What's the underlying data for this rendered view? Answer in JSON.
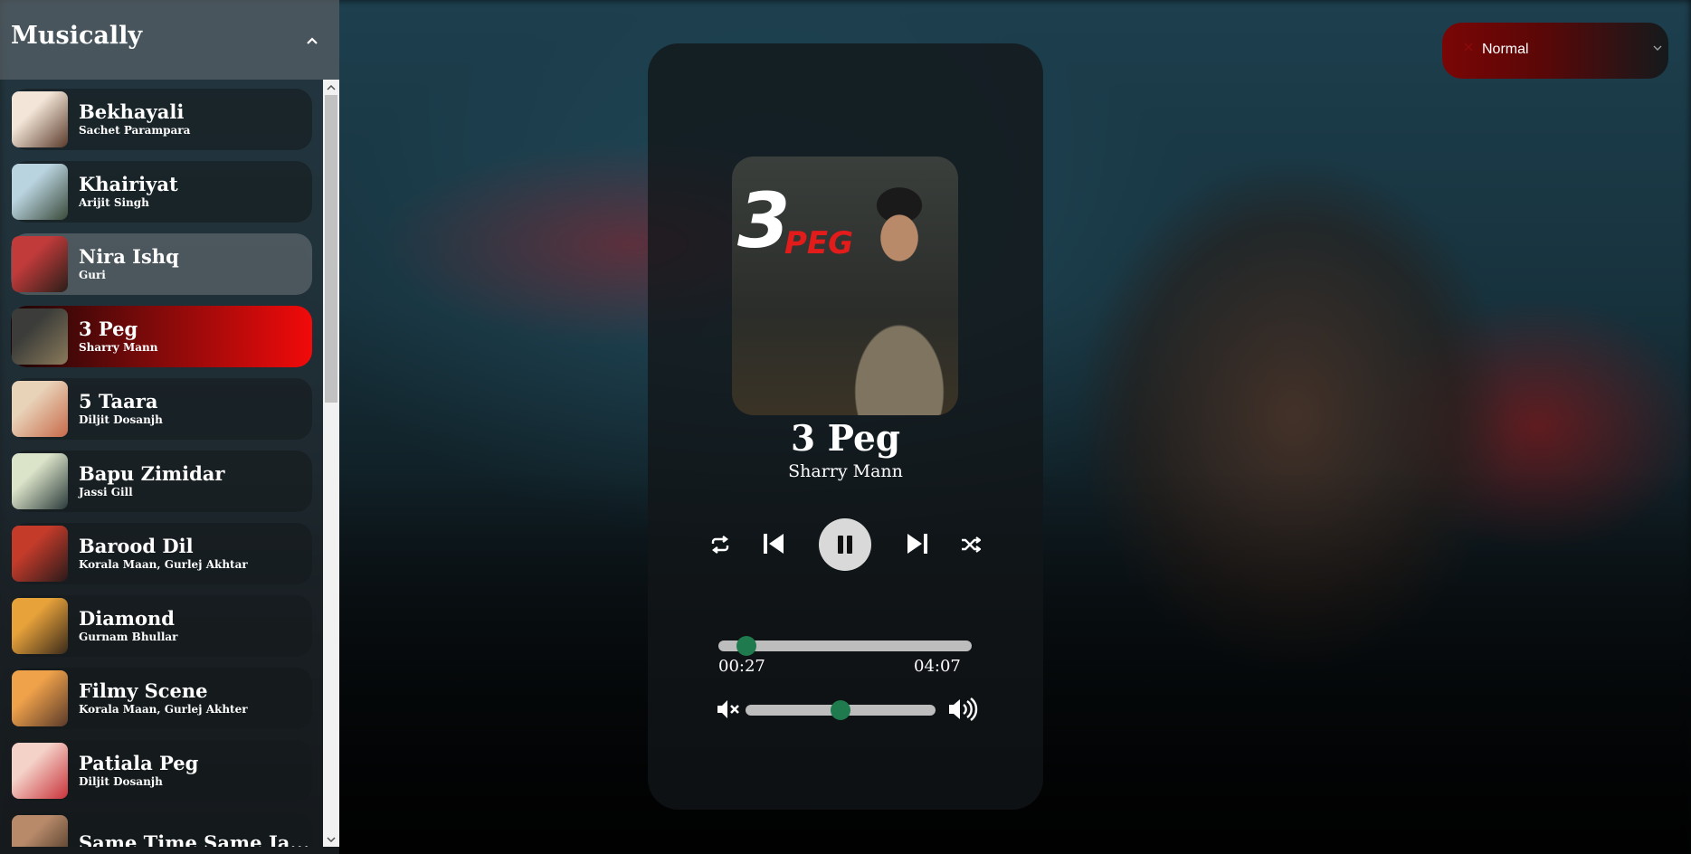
{
  "app": {
    "title": "Musically"
  },
  "playlist": [
    {
      "song": "Bekhayali",
      "artist": "Sachet Parampara",
      "thumb": [
        "#f3e6d8",
        "#5a3a2a"
      ]
    },
    {
      "song": "Khairiyat",
      "artist": "Arijit Singh",
      "thumb": [
        "#b9d3df",
        "#3a4a3a"
      ]
    },
    {
      "song": "Nira Ishq",
      "artist": "Guri",
      "thumb": [
        "#c23b3b",
        "#2a1e18"
      ]
    },
    {
      "song": "3 Peg",
      "artist": "Sharry Mann",
      "thumb": [
        "#3c3d3a",
        "#8a7a5a"
      ]
    },
    {
      "song": "5 Taara",
      "artist": "Diljit Dosanjh",
      "thumb": [
        "#e8d2b8",
        "#c86a4a"
      ]
    },
    {
      "song": "Bapu Zimidar",
      "artist": "Jassi Gill",
      "thumb": [
        "#dbe3c8",
        "#2a3a3a"
      ]
    },
    {
      "song": "Barood Dil",
      "artist": "Korala Maan, Gurlej Akhtar",
      "thumb": [
        "#c43b2a",
        "#2a1a1a"
      ]
    },
    {
      "song": "Diamond",
      "artist": "Gurnam Bhullar",
      "thumb": [
        "#e8a23a",
        "#3a2a1a"
      ]
    },
    {
      "song": "Filmy Scene",
      "artist": "Korala Maan, Gurlej Akhter",
      "thumb": [
        "#f0a24a",
        "#5a3a2a"
      ]
    },
    {
      "song": "Patiala Peg",
      "artist": "Diljit Dosanjh",
      "thumb": [
        "#f4d2c8",
        "#c8323a"
      ]
    },
    {
      "song": "Same Time Same Ja...",
      "artist": "",
      "thumb": [
        "#b88a6a",
        "#3a2a1a"
      ]
    }
  ],
  "now_playing": {
    "title": "3 Peg",
    "artist": "Sharry Mann",
    "cover_text_main": "3",
    "cover_text_sub": "PEG",
    "current_time": "00:27",
    "duration": "04:07",
    "progress_fraction": 0.11,
    "volume_fraction": 0.5
  },
  "controls": {
    "repeat_icon": "repeat-icon",
    "prev_icon": "skip-previous-icon",
    "play_icon": "pause-icon",
    "next_icon": "skip-next-icon",
    "shuffle_icon": "shuffle-icon",
    "mute_icon": "volume-mute-icon",
    "volume_icon": "volume-high-icon"
  },
  "mode_select": {
    "value": "Normal"
  },
  "colors": {
    "accent_red": "#f20a0a",
    "slider_thumb": "#1f7a4d",
    "slider_track": "#bdbdbd"
  }
}
